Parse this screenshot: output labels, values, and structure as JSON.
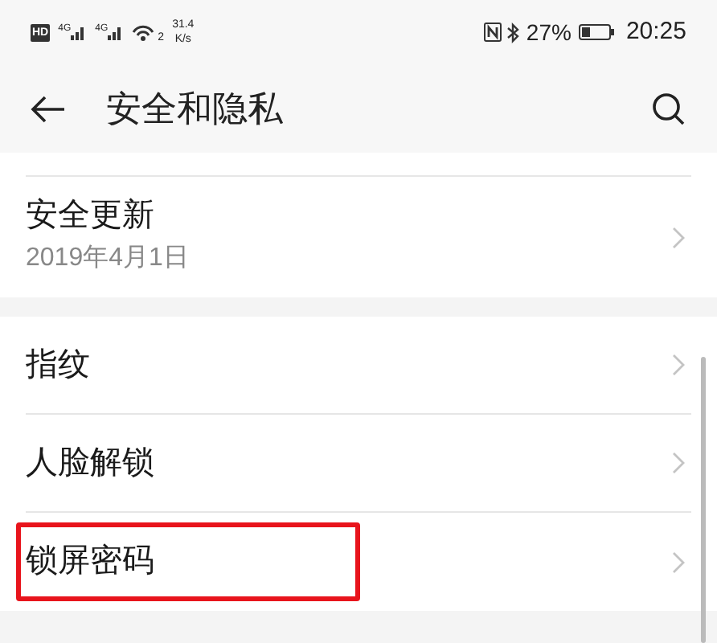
{
  "status_bar": {
    "hd": "HD",
    "sim1": "4G",
    "sim2": "4G",
    "wifi_badge": "2",
    "speed": "31.4",
    "speed_unit": "K/s",
    "battery": "27%",
    "time": "20:25"
  },
  "header": {
    "title": "安全和隐私"
  },
  "groups": [
    {
      "items": [
        {
          "label": "安全更新",
          "subtitle": "2019年4月1日",
          "highlighted": false
        }
      ]
    },
    {
      "items": [
        {
          "label": "指纹",
          "highlighted": false
        },
        {
          "label": "人脸解锁",
          "highlighted": false
        },
        {
          "label": "锁屏密码",
          "highlighted": true
        }
      ]
    }
  ]
}
